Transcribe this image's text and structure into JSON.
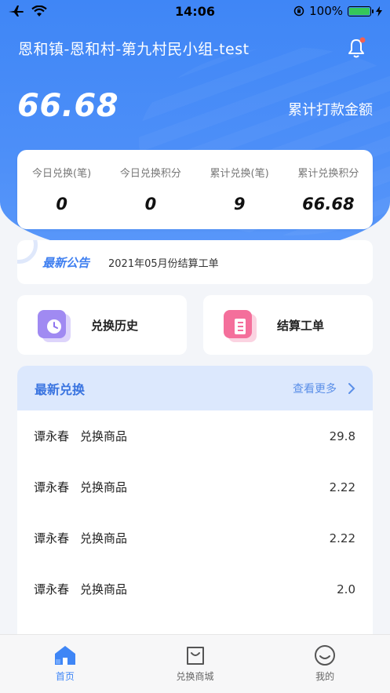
{
  "status_bar": {
    "time": "14:06",
    "battery": "100%"
  },
  "header": {
    "title": "恩和镇-恩和村-第九村民小组-test"
  },
  "summary": {
    "total_amount": "66.68",
    "total_label": "累计打款金额"
  },
  "stats": [
    {
      "label": "今日兑换(笔)",
      "value": "0"
    },
    {
      "label": "今日兑换积分",
      "value": "0"
    },
    {
      "label": "累计兑换(笔)",
      "value": "9"
    },
    {
      "label": "累计兑换积分",
      "value": "66.68"
    }
  ],
  "notice": {
    "tag": "最新公告",
    "text": "2021年05月份结算工单"
  },
  "actions": [
    {
      "label": "兑换历史",
      "icon": "clock-icon",
      "color": "#9c86f0"
    },
    {
      "label": "结算工单",
      "icon": "list-icon",
      "color": "#f36d99"
    }
  ],
  "recent": {
    "title": "最新兑换",
    "more": "查看更多",
    "rows": [
      {
        "name": "谭永春",
        "item": "兑换商品",
        "amount": "29.8"
      },
      {
        "name": "谭永春",
        "item": "兑换商品",
        "amount": "2.22"
      },
      {
        "name": "谭永春",
        "item": "兑换商品",
        "amount": "2.22"
      },
      {
        "name": "谭永春",
        "item": "兑换商品",
        "amount": "2.0"
      }
    ]
  },
  "tabbar": [
    {
      "label": "首页",
      "icon": "home-icon",
      "active": true
    },
    {
      "label": "兑换商城",
      "icon": "shopping-bag-icon",
      "active": false
    },
    {
      "label": "我的",
      "icon": "smiley-icon",
      "active": false
    }
  ],
  "colors": {
    "primary": "#3f86f6",
    "accent_text": "#3a74e0"
  }
}
